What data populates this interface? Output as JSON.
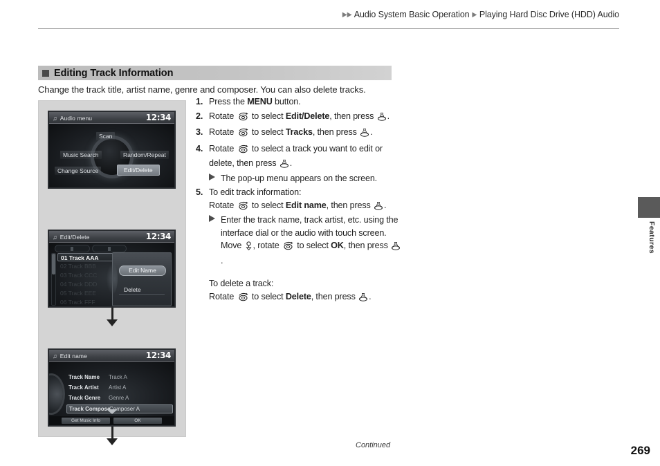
{
  "header": {
    "breadcrumb": [
      {
        "label": "Audio System Basic Operation",
        "arrows": 2
      },
      {
        "label": "Playing Hard Disc Drive (HDD) Audio",
        "arrows": 1
      }
    ]
  },
  "section": {
    "title": "Editing Track Information",
    "intro": "Change the track title, artist name, genre and composer. You can also delete tracks."
  },
  "steps": [
    {
      "num": "1.",
      "parts": [
        {
          "t": "Press the "
        },
        {
          "t": "MENU",
          "b": true
        },
        {
          "t": " button."
        }
      ]
    },
    {
      "num": "2.",
      "parts": [
        {
          "t": "Rotate "
        },
        {
          "icon": "rotate-dial-icon"
        },
        {
          "t": " to select "
        },
        {
          "t": "Edit/Delete",
          "b": true
        },
        {
          "t": ", then press "
        },
        {
          "icon": "press-dial-icon"
        },
        {
          "t": "."
        }
      ]
    },
    {
      "num": "3.",
      "parts": [
        {
          "t": "Rotate "
        },
        {
          "icon": "rotate-dial-icon"
        },
        {
          "t": " to select "
        },
        {
          "t": "Tracks",
          "b": true
        },
        {
          "t": ", then press "
        },
        {
          "icon": "press-dial-icon"
        },
        {
          "t": "."
        }
      ]
    },
    {
      "num": "4.",
      "parts": [
        {
          "t": "Rotate "
        },
        {
          "icon": "rotate-dial-icon"
        },
        {
          "t": " to select a track you want to edit or delete, then press "
        },
        {
          "icon": "press-dial-icon"
        },
        {
          "t": "."
        }
      ],
      "sub": [
        {
          "parts": [
            {
              "t": "The pop-up menu appears on the screen."
            }
          ]
        }
      ]
    },
    {
      "num": "5.",
      "parts": [
        {
          "t": "To edit track information:"
        }
      ],
      "extra": [
        {
          "type": "plain",
          "parts": [
            {
              "t": "Rotate "
            },
            {
              "icon": "rotate-dial-icon"
            },
            {
              "t": " to select "
            },
            {
              "t": "Edit name",
              "b": true
            },
            {
              "t": ", then press "
            },
            {
              "icon": "press-dial-icon"
            },
            {
              "t": "."
            }
          ]
        },
        {
          "type": "sub",
          "parts": [
            {
              "t": "Enter the track name, track artist, etc. using the interface dial or the audio with touch screen. Move "
            },
            {
              "icon": "move-joystick-icon"
            },
            {
              "t": ", rotate "
            },
            {
              "icon": "rotate-dial-icon"
            },
            {
              "t": " to select "
            },
            {
              "t": "OK",
              "b": true
            },
            {
              "t": ", then press "
            },
            {
              "icon": "press-dial-icon"
            },
            {
              "t": "."
            }
          ]
        },
        {
          "type": "gap"
        },
        {
          "type": "plain",
          "parts": [
            {
              "t": "To delete a track:"
            }
          ]
        },
        {
          "type": "plain",
          "parts": [
            {
              "t": "Rotate "
            },
            {
              "icon": "rotate-dial-icon"
            },
            {
              "t": " to select "
            },
            {
              "t": "Delete",
              "b": true
            },
            {
              "t": ", then press "
            },
            {
              "icon": "press-dial-icon"
            },
            {
              "t": "."
            }
          ]
        }
      ]
    }
  ],
  "screens": {
    "audio_menu": {
      "title": "Audio menu",
      "clock": "12:34",
      "items": [
        {
          "label": "Scan",
          "selected": false
        },
        {
          "label": "Music Search",
          "selected": false
        },
        {
          "label": "Random/Repeat",
          "selected": false
        },
        {
          "label": "Change Source",
          "selected": false
        },
        {
          "label": "Edit/Delete",
          "selected": true
        }
      ]
    },
    "edit_delete": {
      "title": "Edit/Delete",
      "clock": "12:34",
      "tracks": [
        {
          "label": "01 Track AAA",
          "selected": true
        },
        {
          "label": "02 Track BBB",
          "selected": false
        },
        {
          "label": "03 Track CCC",
          "selected": false
        },
        {
          "label": "04 Track DDD",
          "selected": false
        },
        {
          "label": "05 Track EEE",
          "selected": false
        },
        {
          "label": "06 Track FFF",
          "selected": false
        }
      ],
      "popup": [
        {
          "label": "Edit Name",
          "selected": true
        },
        {
          "label": "Delete",
          "selected": false
        }
      ]
    },
    "edit_name": {
      "title": "Edit name",
      "clock": "12:34",
      "fields": [
        {
          "label": "Track Name",
          "value": "Track A",
          "selected": false
        },
        {
          "label": "Track Artist",
          "value": "Artist A",
          "selected": false
        },
        {
          "label": "Track Genre",
          "value": "Genre A",
          "selected": false
        },
        {
          "label": "Track Compose",
          "value": "Composer A",
          "selected": true
        }
      ],
      "buttons": [
        {
          "label": "Get Music Info"
        },
        {
          "label": "OK"
        }
      ]
    }
  },
  "side_tab": {
    "label": "Features"
  },
  "footer": {
    "continued": "Continued",
    "page": "269"
  }
}
